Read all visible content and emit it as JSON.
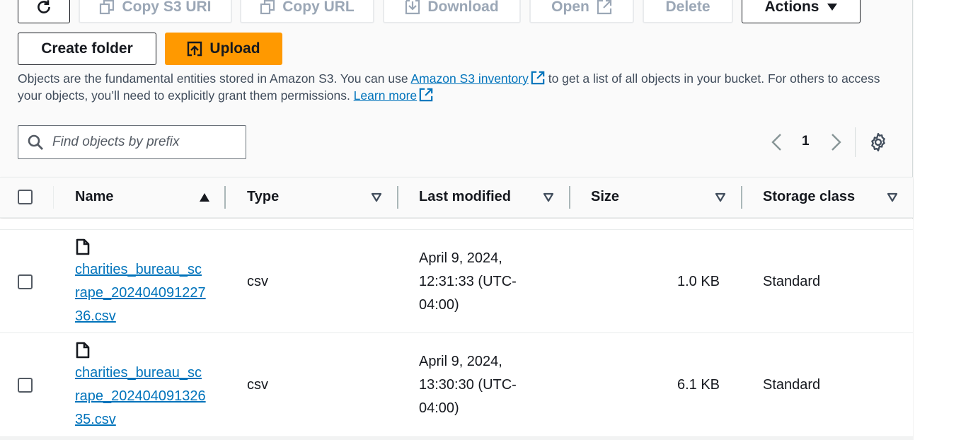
{
  "toolbar": {
    "copy_s3_uri": "Copy S3 URI",
    "copy_url": "Copy URL",
    "download": "Download",
    "open": "Open",
    "delete": "Delete",
    "actions": "Actions",
    "create_folder": "Create folder",
    "upload": "Upload"
  },
  "description": {
    "part1": "Objects are the fundamental entities stored in Amazon S3. You can use ",
    "link1": "Amazon S3 inventory",
    "part2": " to get a list of all objects in your bucket. For others to access your objects, you’ll need to explicitly grant them permissions. ",
    "link2": "Learn more"
  },
  "search": {
    "placeholder": "Find objects by prefix"
  },
  "pagination": {
    "current_page": "1"
  },
  "table": {
    "columns": [
      "Name",
      "Type",
      "Last modified",
      "Size",
      "Storage class"
    ],
    "rows": [
      {
        "name": "charities_bureau_scrape_20240409122736.csv",
        "type": "csv",
        "last_modified": "April 9, 2024, 12:31:33 (UTC-04:00)",
        "size": "1.0 KB",
        "storage_class": "Standard"
      },
      {
        "name": "charities_bureau_scrape_20240409132635.csv",
        "type": "csv",
        "last_modified": "April 9, 2024, 13:30:30 (UTC-04:00)",
        "size": "6.1 KB",
        "storage_class": "Standard"
      }
    ]
  },
  "colors": {
    "accent": "#ff9900",
    "link": "#0073bb"
  }
}
